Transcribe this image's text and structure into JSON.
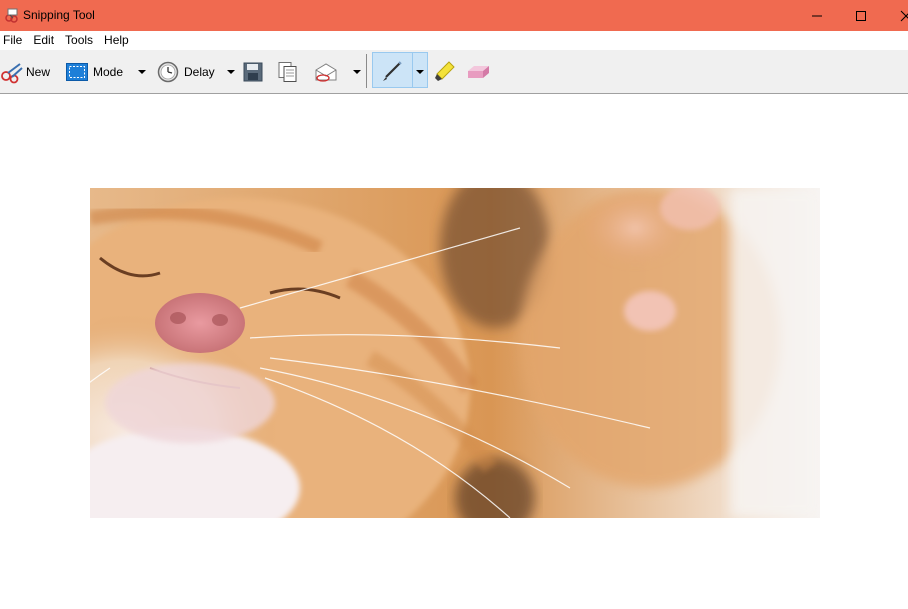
{
  "window": {
    "title": "Snipping Tool"
  },
  "menu": {
    "items": [
      "File",
      "Edit",
      "Tools",
      "Help"
    ]
  },
  "toolbar": {
    "new_label": "New",
    "mode_label": "Mode",
    "delay_label": "Delay",
    "icons": [
      "scissors-icon",
      "mode-rectangle-icon",
      "clock-icon",
      "save-icon",
      "copy-icon",
      "send-email-icon",
      "pen-icon",
      "highlighter-icon",
      "eraser-icon"
    ]
  },
  "capture": {
    "description_icon": "kitten-photo",
    "colors": {
      "fur_orange": "#d9904a",
      "fur_light": "#f3dcc3",
      "nose_pink": "#e8949a",
      "background_white": "#f6f3f1"
    }
  },
  "colors": {
    "titlebar": "#f06a50",
    "toolbar_bg": "#f0f0f0",
    "active_tool": "#cce4f7"
  }
}
